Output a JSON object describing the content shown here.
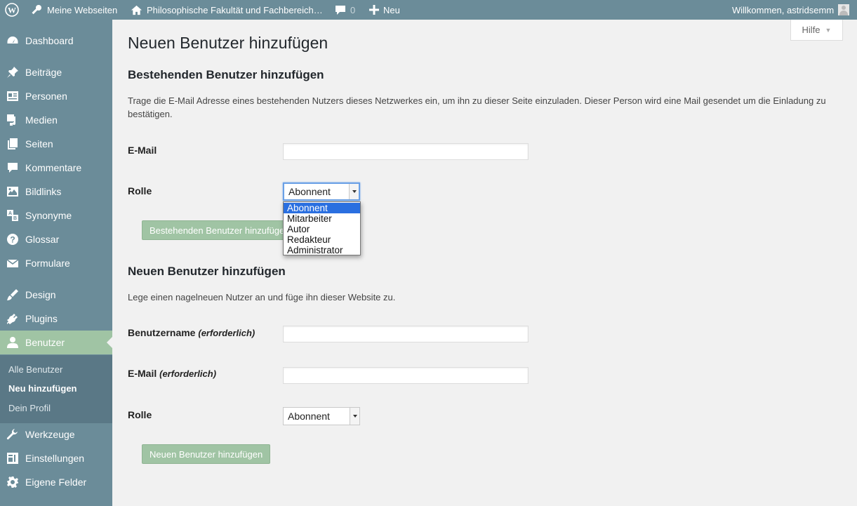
{
  "adminbar": {
    "my_sites": "Meine Webseiten",
    "site_name": "Philosophische Fakultät und Fachbereich…",
    "comments_count": "0",
    "new_label": "Neu",
    "welcome": "Willkommen, astridsemm"
  },
  "help_tab": {
    "label": "Hilfe"
  },
  "sidebar": {
    "items": [
      {
        "label": "Dashboard",
        "icon": "dashboard-icon"
      },
      {
        "label": "Beiträge",
        "icon": "pin-icon"
      },
      {
        "label": "Personen",
        "icon": "id-card-icon"
      },
      {
        "label": "Medien",
        "icon": "media-icon"
      },
      {
        "label": "Seiten",
        "icon": "pages-icon"
      },
      {
        "label": "Kommentare",
        "icon": "comment-icon"
      },
      {
        "label": "Bildlinks",
        "icon": "image-icon"
      },
      {
        "label": "Synonyme",
        "icon": "translate-icon"
      },
      {
        "label": "Glossar",
        "icon": "help-icon"
      },
      {
        "label": "Formulare",
        "icon": "email-icon"
      },
      {
        "label": "Design",
        "icon": "brush-icon"
      },
      {
        "label": "Plugins",
        "icon": "plugin-icon"
      },
      {
        "label": "Benutzer",
        "icon": "user-icon"
      },
      {
        "label": "Werkzeuge",
        "icon": "wrench-icon"
      },
      {
        "label": "Einstellungen",
        "icon": "settings-icon"
      },
      {
        "label": "Eigene Felder",
        "icon": "gear-icon"
      }
    ],
    "submenu": [
      "Alle Benutzer",
      "Neu hinzufügen",
      "Dein Profil"
    ]
  },
  "page": {
    "title": "Neuen Benutzer hinzufügen",
    "existing": {
      "heading": "Bestehenden Benutzer hinzufügen",
      "description": "Trage die E-Mail Adresse eines bestehenden Nutzers dieses Netzwerkes ein, um ihn zu dieser Seite einzuladen. Dieser Person wird eine Mail gesendet um die Einladung zu bestätigen.",
      "email_label": "E-Mail",
      "email_value": "",
      "role_label": "Rolle",
      "role_value": "Abonnent",
      "role_options": [
        "Abonnent",
        "Mitarbeiter",
        "Autor",
        "Redakteur",
        "Administrator"
      ],
      "submit_label": "Bestehenden Benutzer hinzufügen"
    },
    "new": {
      "heading": "Neuen Benutzer hinzufügen",
      "description": "Lege einen nagelneuen Nutzer an und füge ihn dieser Website zu.",
      "username_label": "Benutzername",
      "email_label": "E-Mail",
      "required_note": "(erforderlich)",
      "username_value": "",
      "email_value": "",
      "role_label": "Rolle",
      "role_value": "Abonnent",
      "submit_label": "Neuen Benutzer hinzufügen"
    }
  },
  "colors": {
    "adminbar": "#6b8c99",
    "sidebar": "#6b8c99",
    "accent": "#a0c4a4",
    "selected_option": "#2a6fe0"
  }
}
